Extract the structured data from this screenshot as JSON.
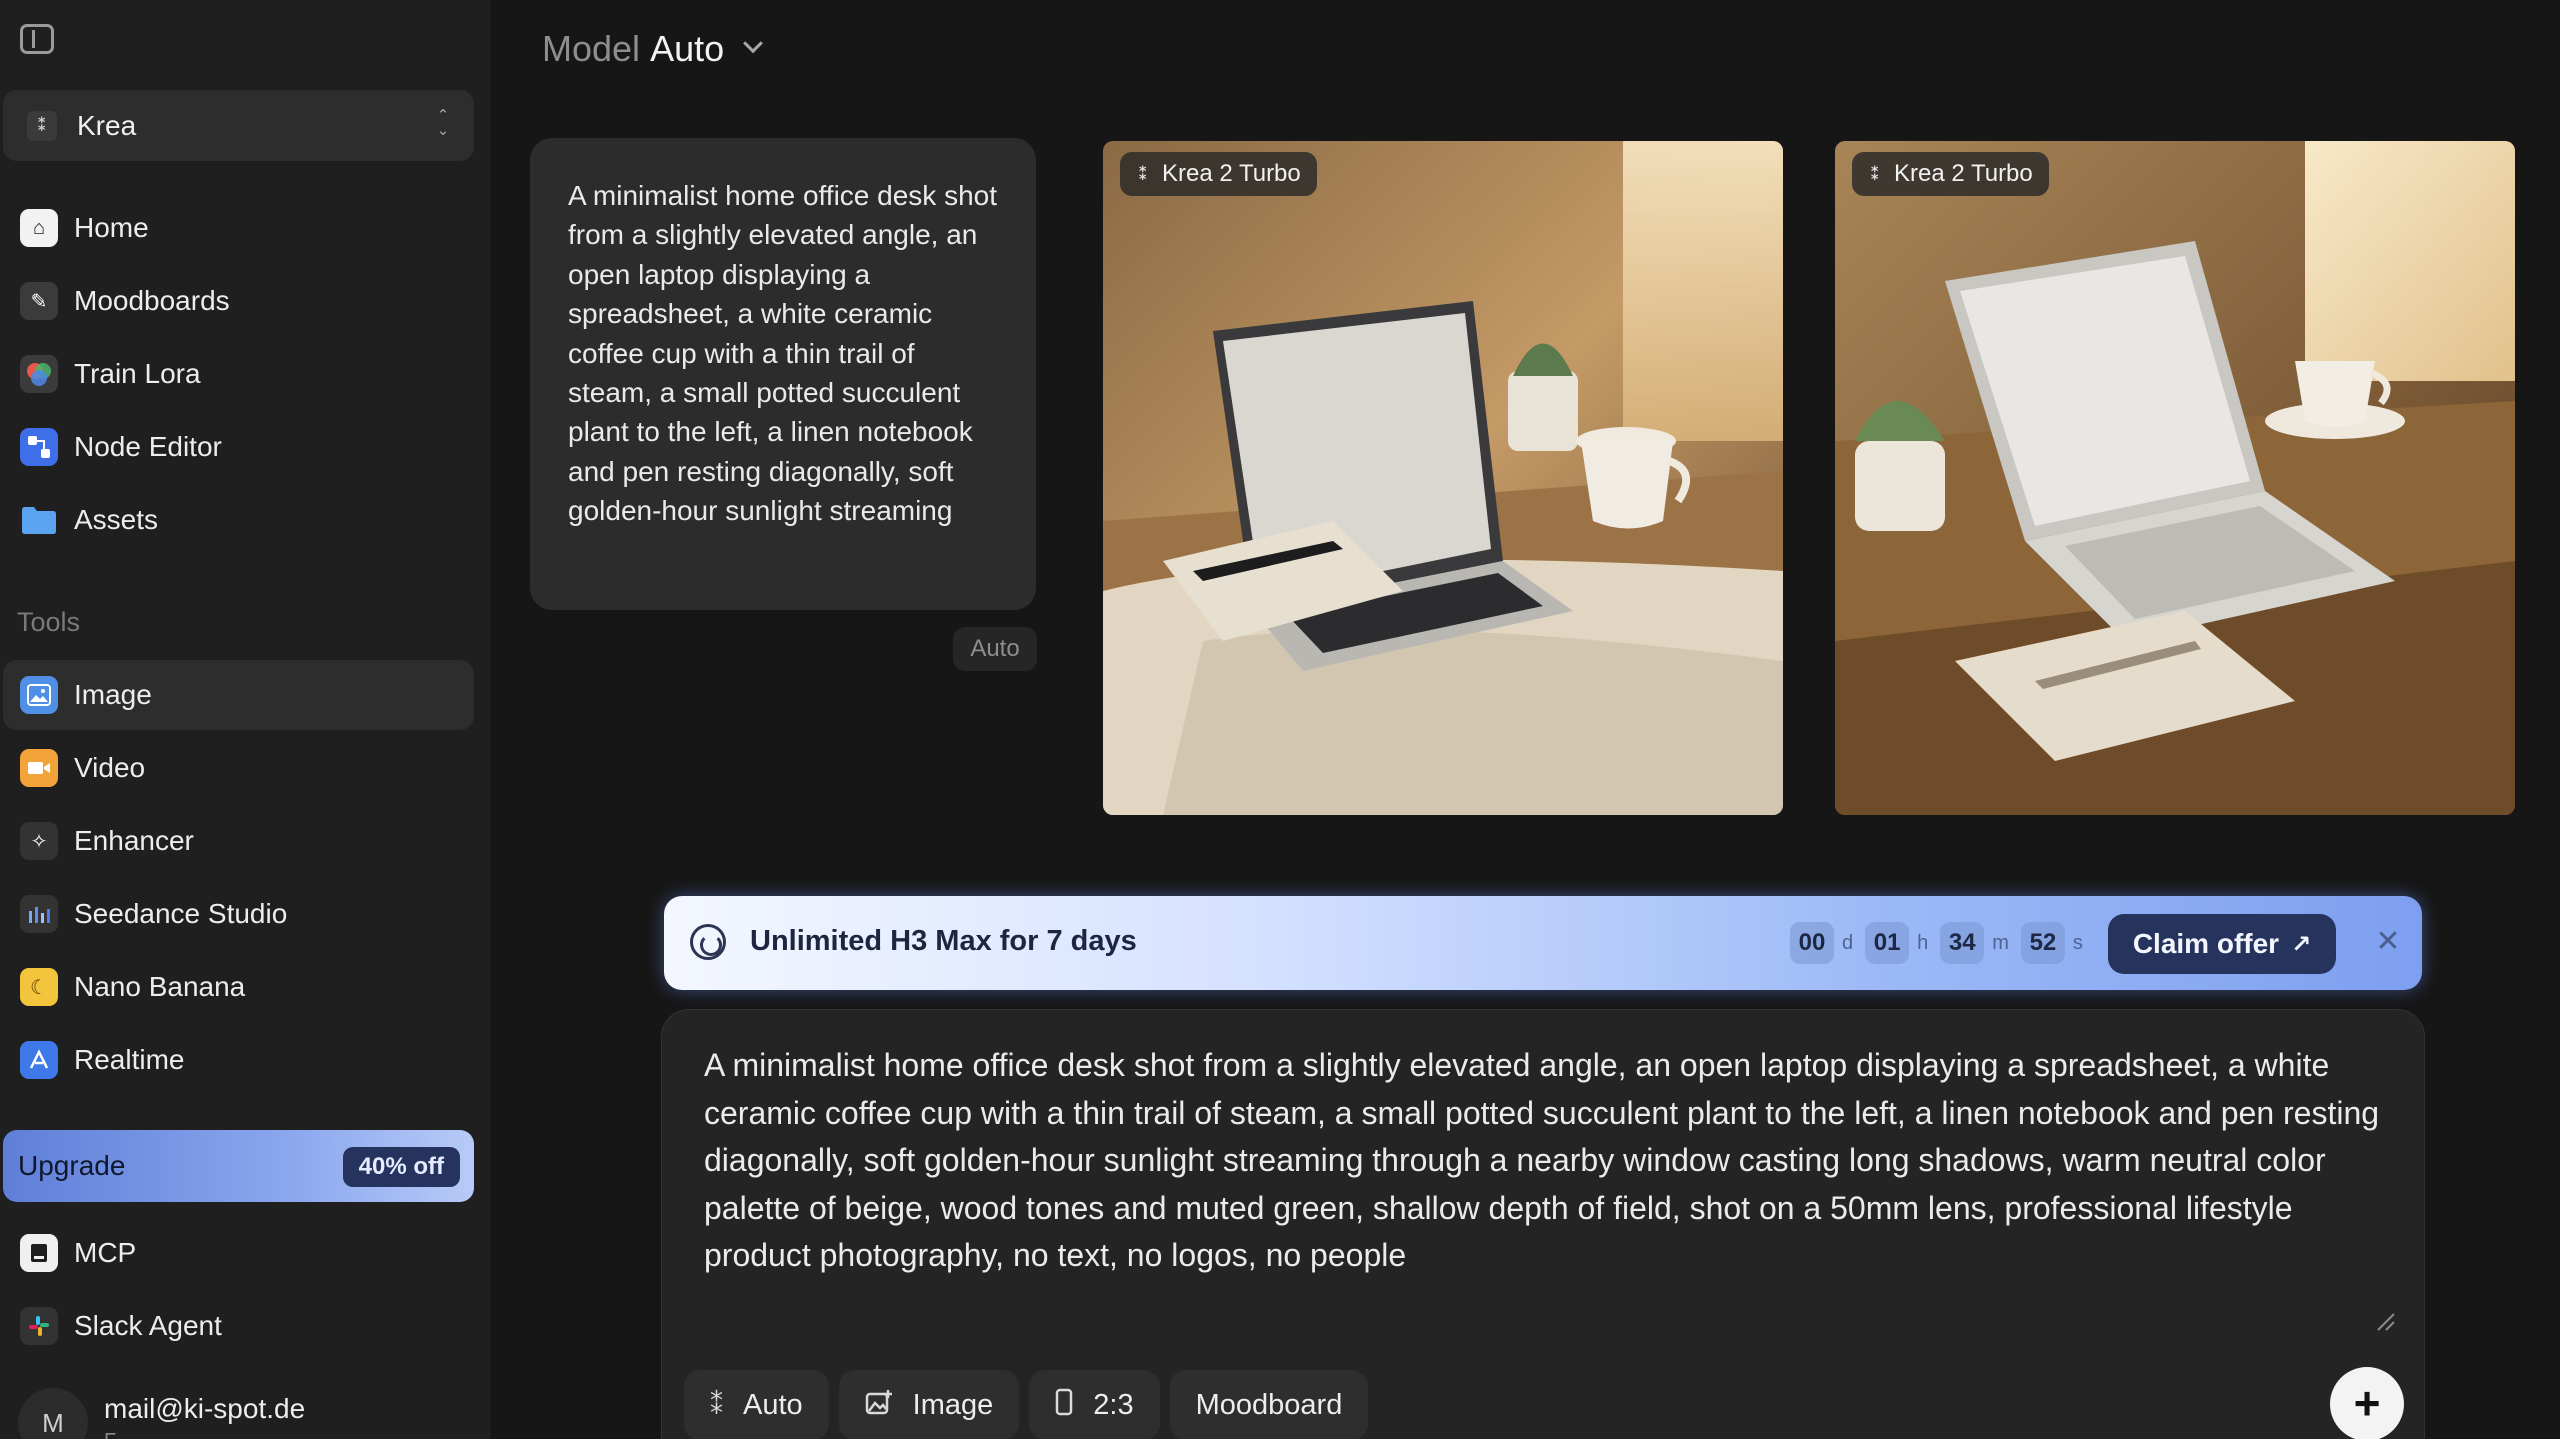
{
  "sidebar": {
    "workspace": {
      "name": "Krea",
      "icon": "krea-logo-icon"
    },
    "nav_items": [
      {
        "label": "Home",
        "icon": "home-icon",
        "color": "#f2f2f2"
      },
      {
        "label": "Moodboards",
        "icon": "moodboard-brush-icon",
        "color": "#3b3b3b"
      },
      {
        "label": "Train Lora",
        "icon": "train-lora-icon",
        "color": "#3b3b3b"
      },
      {
        "label": "Node Editor",
        "icon": "node-editor-icon",
        "color": "#3f6fe8"
      },
      {
        "label": "Assets",
        "icon": "folder-icon",
        "color": "#5aa3f0"
      }
    ],
    "tools_label": "Tools",
    "tool_items": [
      {
        "label": "Image",
        "icon": "image-icon",
        "color": "#4f8fe6",
        "active": true
      },
      {
        "label": "Video",
        "icon": "video-icon",
        "color": "#f2a43a"
      },
      {
        "label": "Enhancer",
        "icon": "enhancer-icon",
        "color": "#333333"
      },
      {
        "label": "Seedance Studio",
        "icon": "seedance-icon",
        "color": "#333333"
      },
      {
        "label": "Nano Banana",
        "icon": "banana-icon",
        "color": "#f3c53c"
      },
      {
        "label": "Realtime",
        "icon": "realtime-icon",
        "color": "#3f78e8"
      }
    ],
    "upgrade": {
      "label": "Upgrade",
      "badge": "40% off"
    },
    "extra_items": [
      {
        "label": "MCP",
        "icon": "mcp-icon",
        "color": "#f0f0f0"
      },
      {
        "label": "Slack Agent",
        "icon": "slack-icon",
        "color": "#333333"
      }
    ],
    "account": {
      "avatar_letter": "M",
      "email": "mail@ki-spot.de",
      "sub": "F"
    }
  },
  "header": {
    "model_prefix": "Model",
    "model_value": "Auto"
  },
  "conversation": {
    "prompt": "A minimalist home office desk shot from a slightly elevated angle, an open laptop displaying a spreadsheet, a white ceramic coffee cup with a thin trail of steam, a small potted succulent plant to the left, a linen notebook and pen resting diagonally, soft golden-hour sunlight streaming",
    "model_chip": "Auto",
    "results": [
      {
        "model_tag": "Krea 2 Turbo"
      },
      {
        "model_tag": "Krea 2 Turbo"
      }
    ]
  },
  "promo": {
    "title": "Unlimited H3 Max for 7 days",
    "countdown": [
      {
        "value": "00",
        "unit": "d"
      },
      {
        "value": "01",
        "unit": "h"
      },
      {
        "value": "34",
        "unit": "m"
      },
      {
        "value": "52",
        "unit": "s"
      }
    ],
    "cta": "Claim offer",
    "cta_arrow": "↗",
    "close": "✕"
  },
  "composer": {
    "text": "A minimalist home office desk shot from a slightly elevated angle, an open laptop displaying a spreadsheet, a white ceramic coffee cup with a thin trail of steam, a small potted succulent plant to the left, a linen notebook and pen resting diagonally, soft golden-hour sunlight streaming through a nearby window casting long shadows, warm neutral color palette of beige, wood tones and muted green, shallow depth of field, shot on a 50mm lens, professional lifestyle product photography, no text, no logos, no people",
    "chips": [
      {
        "label": "Auto",
        "icon": "krea-logo-icon"
      },
      {
        "label": "Image",
        "icon": "image-plus-icon"
      },
      {
        "label": "2:3",
        "icon": "aspect-ratio-icon"
      },
      {
        "label": "Moodboard",
        "icon": ""
      }
    ],
    "send": "+"
  }
}
